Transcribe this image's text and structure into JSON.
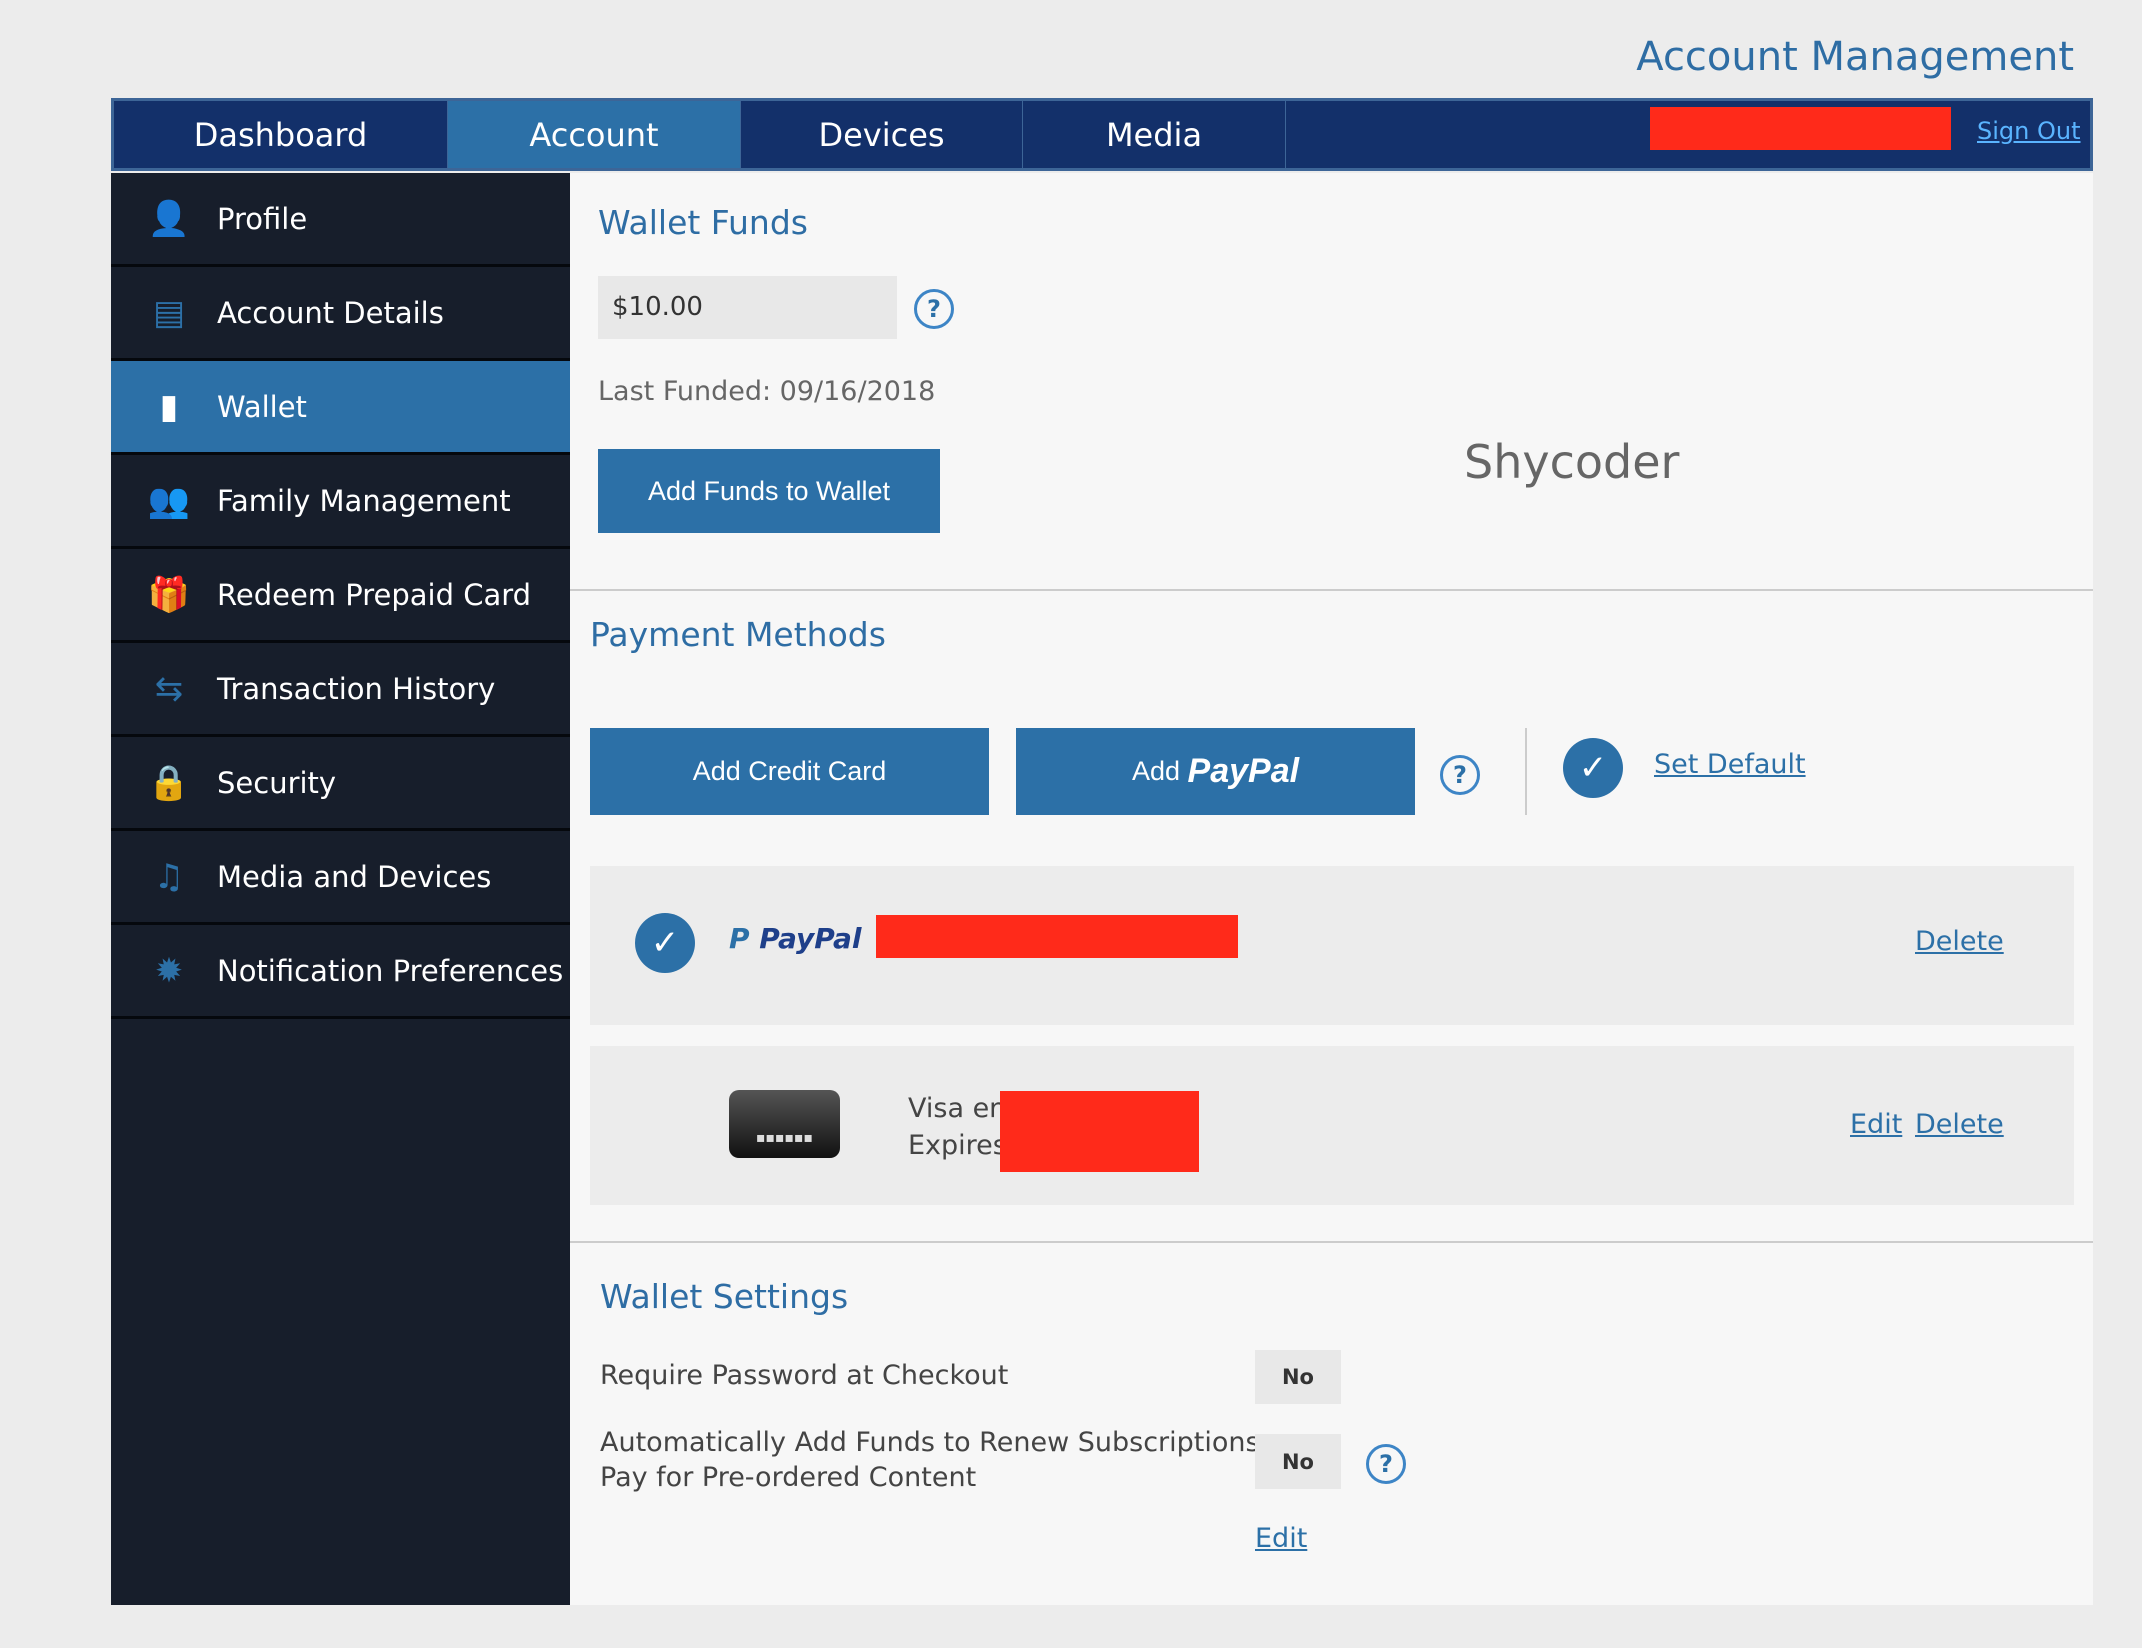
{
  "header": {
    "title": "Account Management",
    "sign_out": "Sign Out"
  },
  "tabs": [
    {
      "label": "Dashboard"
    },
    {
      "label": "Account",
      "active": true
    },
    {
      "label": "Devices"
    },
    {
      "label": "Media"
    }
  ],
  "sidebar": {
    "items": [
      {
        "label": "Profile",
        "icon": "person-icon"
      },
      {
        "label": "Account Details",
        "icon": "document-icon"
      },
      {
        "label": "Wallet",
        "icon": "wallet-icon",
        "active": true
      },
      {
        "label": "Family Management",
        "icon": "people-icon"
      },
      {
        "label": "Redeem Prepaid Card",
        "icon": "gift-icon"
      },
      {
        "label": "Transaction History",
        "icon": "transfer-arrows-icon"
      },
      {
        "label": "Security",
        "icon": "lock-icon"
      },
      {
        "label": "Media and Devices",
        "icon": "media-icon"
      },
      {
        "label": "Notification Preferences",
        "icon": "gear-burst-icon"
      }
    ]
  },
  "wallet_funds": {
    "heading": "Wallet Funds",
    "amount": "$10.00",
    "last_funded": "Last Funded: 09/16/2018",
    "add_funds": "Add Funds to Wallet",
    "username": "Shycoder"
  },
  "payment_methods": {
    "heading": "Payment Methods",
    "add_credit_card": "Add Credit Card",
    "add_paypal_prefix": "Add",
    "add_paypal_brand": "PayPal",
    "set_default": "Set Default",
    "methods": [
      {
        "brand": "PayPal",
        "default": true,
        "delete": "Delete"
      },
      {
        "line1": "Visa end",
        "line2": "Expires",
        "edit": "Edit",
        "delete": "Delete"
      }
    ]
  },
  "wallet_settings": {
    "heading": "Wallet Settings",
    "settings": [
      {
        "label": "Require Password at Checkout",
        "value": "No"
      },
      {
        "label_line1": "Automatically Add Funds to Renew Subscriptions or",
        "label_line2": "Pay for Pre-ordered Content",
        "value": "No"
      }
    ],
    "edit": "Edit"
  },
  "colors": {
    "nav": "#13306a",
    "accent": "#2c70a7",
    "sidebar": "#171e2b",
    "redaction": "#ff2a1a"
  }
}
